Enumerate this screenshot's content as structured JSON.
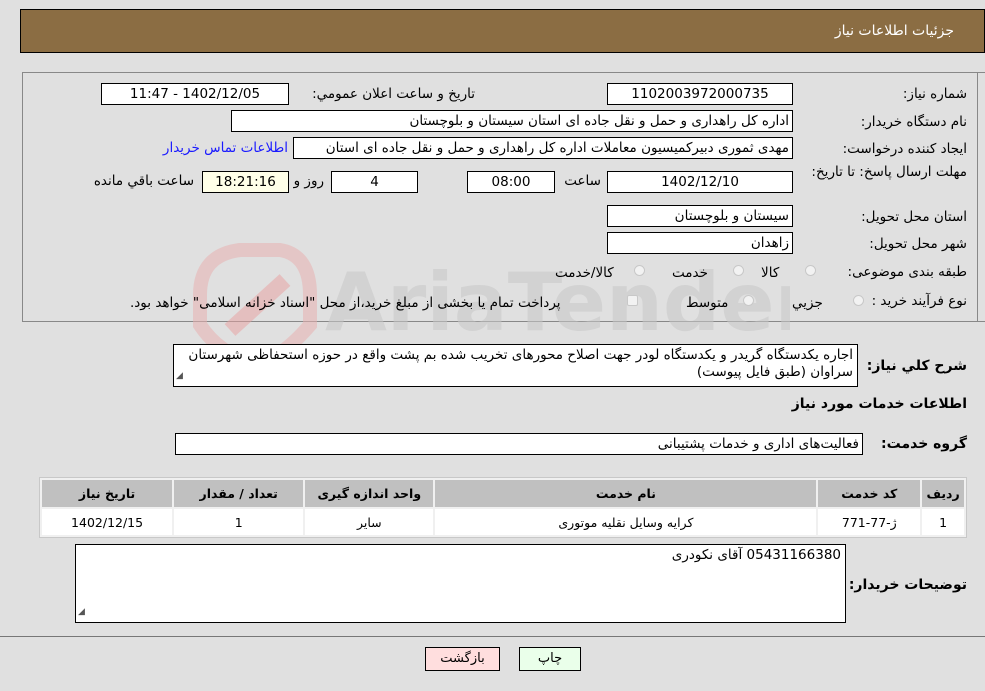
{
  "header": {
    "title": "جزئيات اطلاعات نياز"
  },
  "fields": {
    "need_number": {
      "label": "شماره نياز:",
      "value": "1102003972000735"
    },
    "announce_datetime": {
      "label": "تاريخ و ساعت اعلان عمومي:",
      "value": "1402/12/05 - 11:47"
    },
    "buyer_org": {
      "label": "نام دستگاه خريدار:",
      "value": "اداره کل راهداری و حمل و نقل جاده ای استان سیستان و بلوچستان"
    },
    "requester": {
      "label": "ايجاد کننده درخواست:",
      "value": "مهدی ثموری دبیرکمیسیون معاملات اداره کل راهداری و حمل و نقل جاده ای استان"
    },
    "contact_link": "اطلاعات تماس خريدار",
    "deadline": {
      "label": "مهلت ارسال پاسخ: تا تاريخ:",
      "date": "1402/12/10",
      "time_label": "ساعت",
      "time": "08:00",
      "days": "4",
      "days_label": "روز و",
      "remaining": "18:21:16",
      "remaining_label": "ساعت باقي مانده"
    },
    "province": {
      "label": "استان محل تحويل:",
      "value": "سیستان و بلوچستان"
    },
    "city": {
      "label": "شهر محل تحويل:",
      "value": "زاهدان"
    },
    "category": {
      "label": "طبقه بندی موضوعی:",
      "options": [
        "کالا",
        "خدمت",
        "کالا/خدمت"
      ]
    },
    "process": {
      "label": "نوع فرآيند خريد :",
      "options": [
        "جزيي",
        "متوسط"
      ],
      "treasury_note": "پرداخت تمام يا بخشی از مبلغ خريد،از محل \"اسناد خزانه اسلامی\" خواهد بود."
    }
  },
  "description": {
    "label": "شرح کلي نياز:",
    "value": "اجاره یکدستگاه گریدر و یکدستگاه لودر جهت اصلاح محورهای تخریب شده بم پشت واقع در حوزه استحفاظی شهرستان سراوان (طبق فایل پیوست)"
  },
  "services_section": {
    "title": "اطلاعات خدمات مورد نياز",
    "group_label": "گروه خدمت:",
    "group_value": "فعالیت‌های اداری و خدمات پشتیبانی"
  },
  "table": {
    "headers": [
      "رديف",
      "کد خدمت",
      "نام خدمت",
      "واحد اندازه گيری",
      "تعداد / مقدار",
      "تاريخ نياز"
    ],
    "rows": [
      [
        "1",
        "ژ-77-771",
        "کرایه وسایل نقلیه موتوری",
        "سایر",
        "1",
        "1402/12/15"
      ]
    ]
  },
  "buyer_notes": {
    "label": "توضيحات خريدار:",
    "value": "05431166380 آقای نکودری"
  },
  "buttons": {
    "print": "چاپ",
    "back": "بازگشت"
  },
  "watermark": "AriaTender.neT"
}
